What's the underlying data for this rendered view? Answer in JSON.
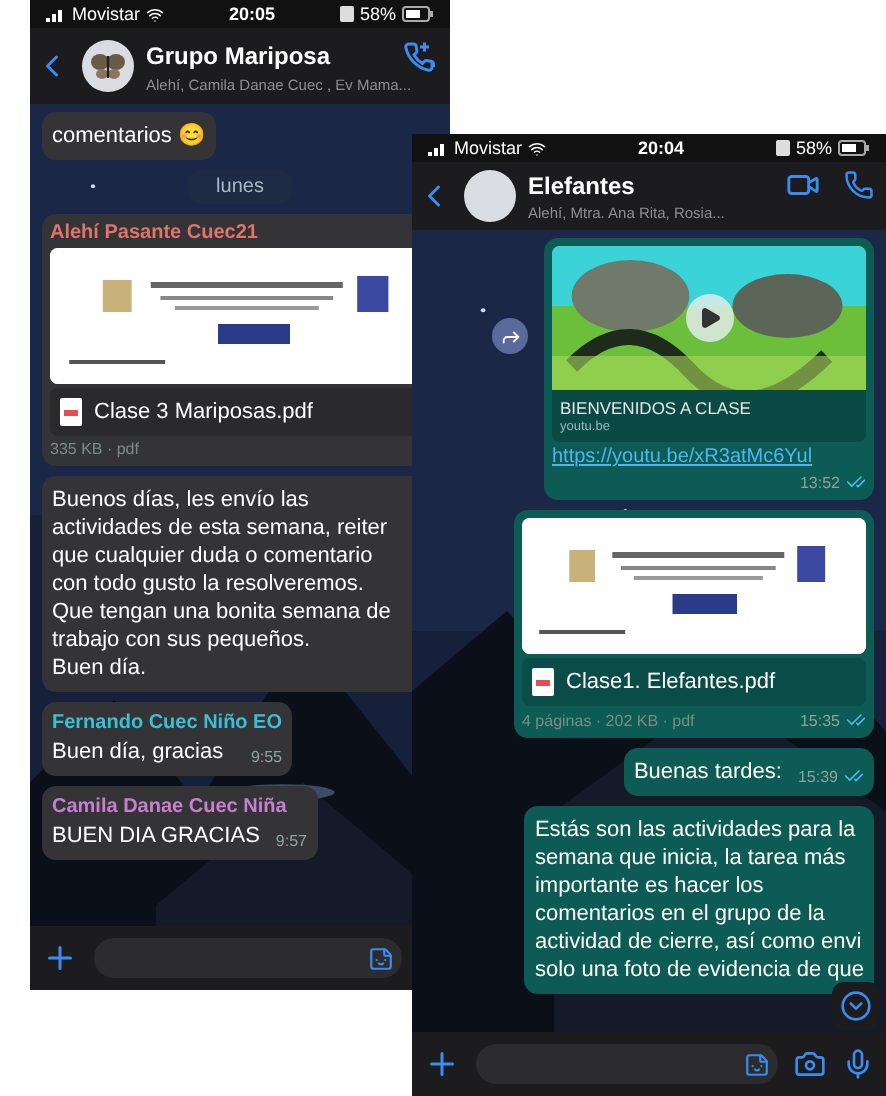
{
  "phones": [
    {
      "status_bar": {
        "carrier": "Movistar",
        "time": "20:05",
        "battery": "58%"
      },
      "header": {
        "title": "Grupo Mariposa",
        "subtitle": "Alehí, Camila Danae Cuec , Ev Mama...",
        "avatar": {
          "kind": "butterfly"
        },
        "actions": [
          {
            "kind": "add-call"
          }
        ]
      },
      "messages": [
        {
          "kind": "text",
          "outgoing": false,
          "text": "comentarios 😊"
        },
        {
          "kind": "date",
          "text": "lunes"
        },
        {
          "kind": "document",
          "outgoing": false,
          "sender": "Alehí Pasante Cuec21",
          "color": "#e0736a",
          "file": "Clase 3 Mariposas.pdf",
          "meta": "335 KB · pdf"
        },
        {
          "kind": "text",
          "outgoing": false,
          "text": "Buenos días, les envío las\nactividades de esta semana, reiter\nque cualquier duda o comentario\ncon todo gusto la resolveremos.\nQue tengan una bonita semana de\ntrabajo con sus pequeños.\nBuen día."
        },
        {
          "kind": "text",
          "outgoing": false,
          "sender": "Fernando Cuec  Niño EO",
          "color": "#3bbfd6",
          "text": "Buen día, gracias",
          "time": "9:55"
        },
        {
          "kind": "text",
          "outgoing": false,
          "sender": "Camila Danae Cuec  Niña",
          "color": "#c77fd0",
          "text": "BUEN DIA GRACIAS",
          "time": "9:57"
        }
      ],
      "input_icons": [
        {
          "kind": "sticker"
        }
      ]
    },
    {
      "status_bar": {
        "carrier": "Movistar",
        "time": "20:04",
        "battery": "58%"
      },
      "header": {
        "title": "Elefantes",
        "subtitle": "Alehí, Mtra. Ana Rita, Rosia...",
        "avatar": {
          "kind": "plain"
        },
        "actions": [
          {
            "kind": "video"
          },
          {
            "kind": "call"
          }
        ]
      },
      "messages": [
        {
          "kind": "link",
          "outgoing": true,
          "forward": true,
          "title": "BIENVENIDOS A CLASE",
          "domain": "youtu.be",
          "url": "https://youtu.be/xR3atMc6Yul",
          "time": "13:52",
          "read": true
        },
        {
          "kind": "document",
          "outgoing": true,
          "file": "Clase1. Elefantes.pdf",
          "meta": "4 páginas · 202 KB · pdf",
          "time": "15:35",
          "read": true
        },
        {
          "kind": "text",
          "outgoing": true,
          "text": "Buenas tardes:",
          "time": "15:39",
          "read": true
        },
        {
          "kind": "text",
          "outgoing": true,
          "text": "Estás son las actividades para la\nsemana que inicia, la tarea más\nimportante es hacer los\ncomentarios en el grupo de la\nactividad de cierre, así como envi\nsolo una foto de evidencia de que"
        }
      ],
      "scroll_down": true,
      "input_icons": [
        {
          "kind": "sticker"
        },
        {
          "kind": "camera"
        },
        {
          "kind": "mic"
        }
      ]
    }
  ]
}
